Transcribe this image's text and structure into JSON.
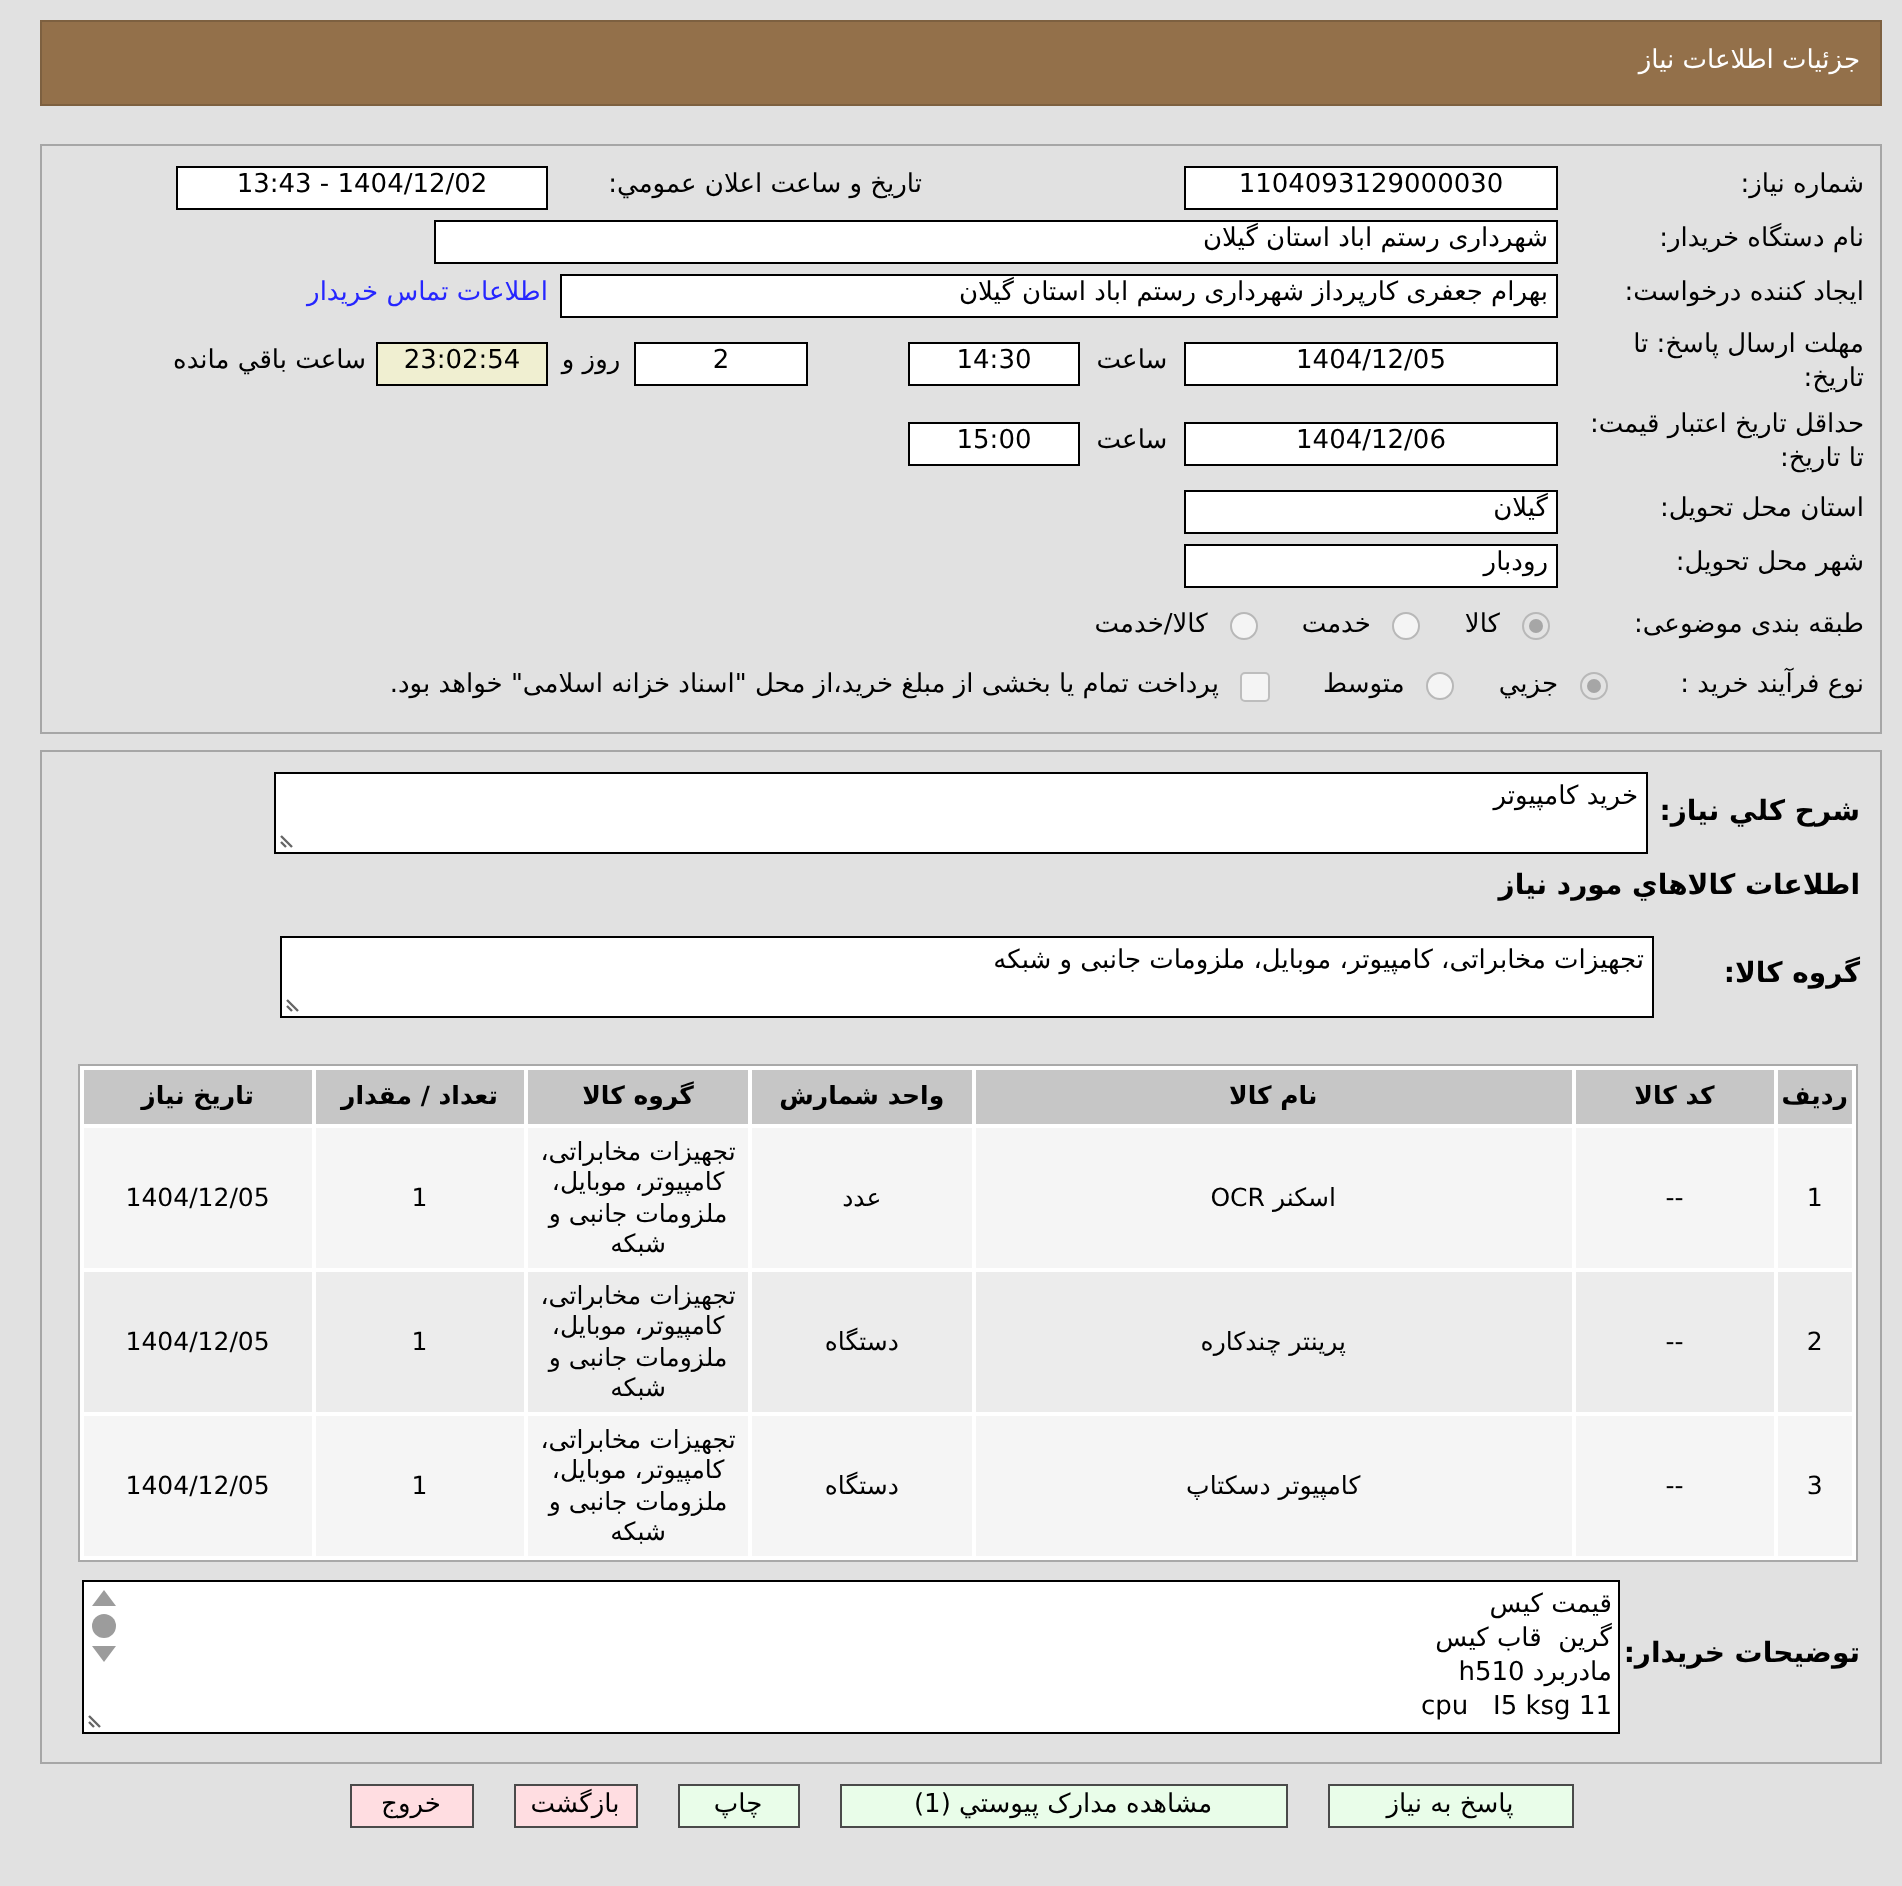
{
  "header": {
    "title": "جزئيات اطلاعات نیاز"
  },
  "details": {
    "need_number": {
      "label": "شماره نیاز:",
      "value": "1104093129000030"
    },
    "announce_datetime": {
      "label": "تاريخ و ساعت اعلان عمومي:",
      "value": "1404/12/02 - 13:43"
    },
    "buyer_org": {
      "label": "نام دستگاه خریدار:",
      "value": "شهرداری رستم اباد استان گیلان"
    },
    "requester": {
      "label": "ایجاد کننده درخواست:",
      "value": "بهرام جعفری کارپرداز شهرداری رستم اباد استان گیلان",
      "contact_link": "اطلاعات تماس خریدار"
    },
    "reply_deadline": {
      "label": "مهلت ارسال پاسخ: تا تاریخ:",
      "date": "1404/12/05",
      "time_label": "ساعت",
      "time": "14:30",
      "days": "2",
      "days_label": "روز و",
      "remaining": "23:02:54",
      "remaining_label": "ساعت باقي مانده"
    },
    "price_validity": {
      "label": "حداقل تاریخ اعتبار قیمت: تا تاریخ:",
      "date": "1404/12/06",
      "time_label": "ساعت",
      "time": "15:00"
    },
    "delivery_province": {
      "label": "استان محل تحویل:",
      "value": "گیلان"
    },
    "delivery_city": {
      "label": "شهر محل تحویل:",
      "value": "رودبار"
    },
    "category": {
      "label": "طبقه بندی موضوعی:",
      "options": [
        {
          "label": "کالا",
          "selected": true
        },
        {
          "label": "خدمت",
          "selected": false
        },
        {
          "label": "کالا/خدمت",
          "selected": false
        }
      ]
    },
    "purchase_process": {
      "label": "نوع فرآیند خرید :",
      "options": [
        {
          "label": "جزيي",
          "selected": true
        },
        {
          "label": "متوسط",
          "selected": false
        }
      ],
      "treasury_payment": {
        "label": "پرداخت تمام یا بخشی از مبلغ خرید،از محل \"اسناد خزانه اسلامی\" خواهد بود.",
        "checked": false
      }
    }
  },
  "need_summary": {
    "label": "شرح کلي نیاز:",
    "value": "خرید کامپیوتر"
  },
  "goods": {
    "title": "اطلاعات کالاهاي مورد نیاز",
    "group_label": "گروه کالا:",
    "group_value": "تجهیزات مخابراتی، کامپیوتر، موبایل، ملزومات جانبی و شبکه",
    "table": {
      "columns": [
        "ردیف",
        "کد کالا",
        "نام کالا",
        "واحد شمارش",
        "گروه کالا",
        "تعداد / مقدار",
        "تاریخ نیاز"
      ],
      "rows": [
        [
          "1",
          "--",
          "اسکنر OCR",
          "عدد",
          "تجهیزات مخابراتی، کامپیوتر، موبایل، ملزومات جانبی و شبکه",
          "1",
          "1404/12/05"
        ],
        [
          "2",
          "--",
          "پرینتر چندکاره",
          "دستگاه",
          "تجهیزات مخابراتی، کامپیوتر، موبایل، ملزومات جانبی و شبکه",
          "1",
          "1404/12/05"
        ],
        [
          "3",
          "--",
          "کامپیوتر دسکتاپ",
          "دستگاه",
          "تجهیزات مخابراتی، کامپیوتر، موبایل، ملزومات جانبی و شبکه",
          "1",
          "1404/12/05"
        ]
      ]
    }
  },
  "buyer_notes": {
    "label": "توضیحات خریدار:",
    "lines": [
      "قیمت کیس",
      "گرین  قاب کیس",
      "مادربرد h510",
      "cpu   I5 ksg 11"
    ]
  },
  "buttons": [
    {
      "label": "پاسخ به نیاز",
      "kind": "action"
    },
    {
      "label": "مشاهده مدارک پیوستي (1)",
      "kind": "action"
    },
    {
      "label": "چاپ",
      "kind": "action"
    },
    {
      "label": "بازگشت",
      "kind": "cancel"
    },
    {
      "label": "خروج",
      "kind": "cancel"
    }
  ]
}
